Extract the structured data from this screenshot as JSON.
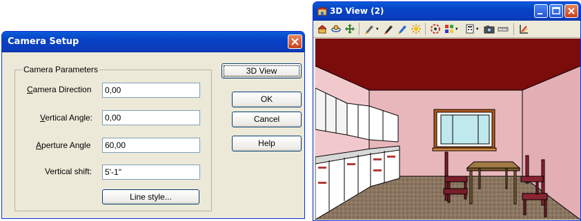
{
  "camera_dialog": {
    "title": "Camera Setup",
    "group_label": "Camera Parameters",
    "fields": [
      {
        "label_u": "C",
        "label_rest": "amera Direction",
        "value": "0,00"
      },
      {
        "label_u": "V",
        "label_rest": "ertical Angle:",
        "value": "0,00"
      },
      {
        "label_u": "A",
        "label_rest": "perture Angle",
        "value": "60,00"
      },
      {
        "label_u": "",
        "label_rest": "Vertical shift:",
        "value": "5'-1''"
      }
    ],
    "line_style_button": "Line style...",
    "buttons": {
      "view3d": "3D View",
      "ok": "OK",
      "cancel": "Cancel",
      "help": "Help"
    }
  },
  "view_window": {
    "title": "3D View (2)",
    "toolbar_icons": [
      "render-icon",
      "orbit-icon",
      "pan-icon",
      "light-brush-icon",
      "paint-brush-icon",
      "paint-icon",
      "sun-icon",
      "walls-icon",
      "materials-icon",
      "calculator-icon",
      "camera-icon",
      "ruler-icon",
      "level-icon"
    ],
    "colors": {
      "ceiling": "#7a0c0c",
      "wall": "#f4d0d3",
      "floor": "#8a7560",
      "table": "#8b6b3c",
      "chair": "#7a1e2a"
    }
  }
}
